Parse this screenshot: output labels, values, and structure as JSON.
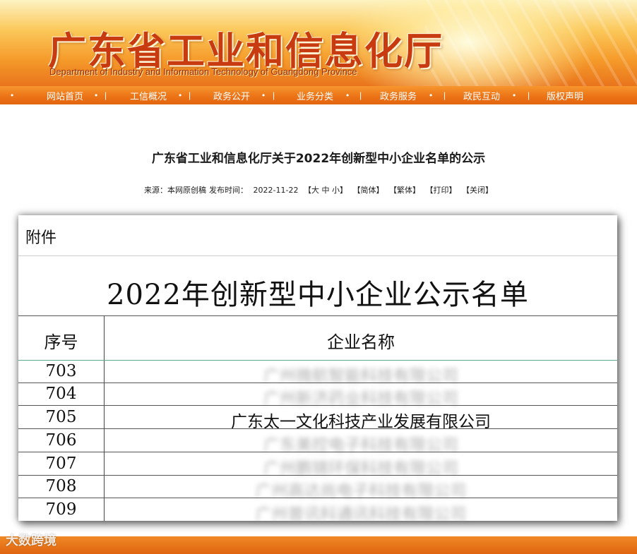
{
  "header": {
    "title": "广东省工业和信息化厅",
    "subtitle": "Department of Industry and Information Technology of Guangdong Province"
  },
  "nav": {
    "items": [
      "网站首页",
      "工信概况",
      "政务公开",
      "业务分类",
      "政务服务",
      "政民互动",
      "版权声明"
    ]
  },
  "article": {
    "title": "广东省工业和信息化厅关于2022年创新型中小企业名单的公示",
    "source_label": "来源：本网原创稿",
    "date_label": "发布时间：",
    "date": "2022-11-22",
    "font_size_label": "【大 中 小】",
    "simplified": "【简体】",
    "traditional": "【繁体】",
    "print": "【打印】",
    "close": "【关闭】"
  },
  "document": {
    "attachment_label": "附件",
    "title": "2022年创新型中小企业公示名单",
    "col_seq": "序号",
    "col_name": "企业名称",
    "rows": [
      {
        "seq": "703",
        "name": "广州微航智能科技有限公司"
      },
      {
        "seq": "704",
        "name": "广州新济药业科技有限公司"
      },
      {
        "seq": "705",
        "name": "广东太一文化科技产业发展有限公司"
      },
      {
        "seq": "706",
        "name": "广东美控电子科技有限公司"
      },
      {
        "seq": "707",
        "name": "广州鹏锦环保科技有限公司"
      },
      {
        "seq": "708",
        "name": "广州高达尚电子科技有限公司"
      },
      {
        "seq": "709",
        "name": "广州普讯科通讯科技有限公司"
      }
    ]
  },
  "footer": {
    "watermark": "大数跨境"
  }
}
